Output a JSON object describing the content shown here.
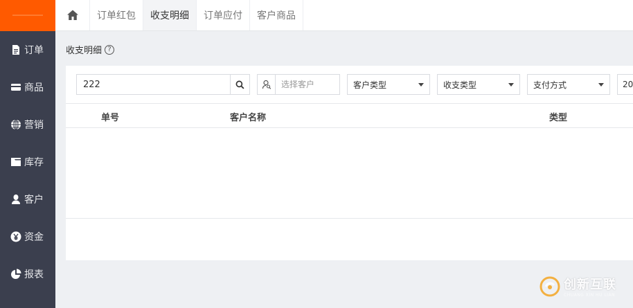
{
  "sidebar": {
    "items": [
      {
        "label": "订单",
        "icon": "document-icon"
      },
      {
        "label": "商品",
        "icon": "card-icon"
      },
      {
        "label": "营销",
        "icon": "globe-icon"
      },
      {
        "label": "库存",
        "icon": "box-icon"
      },
      {
        "label": "客户",
        "icon": "user-icon"
      },
      {
        "label": "资金",
        "icon": "yen-icon"
      },
      {
        "label": "报表",
        "icon": "pie-chart-icon"
      }
    ]
  },
  "tabs": [
    {
      "label": "订单红包",
      "active": false
    },
    {
      "label": "收支明细",
      "active": true
    },
    {
      "label": "订单应付",
      "active": false
    },
    {
      "label": "客户商品",
      "active": false
    }
  ],
  "page": {
    "title": "收支明细",
    "help_glyph": "?"
  },
  "filters": {
    "search_value": "222",
    "customer_placeholder": "选择客户",
    "customer_type": "客户类型",
    "income_type": "收支类型",
    "payment_method": "支付方式",
    "date_partial": "20"
  },
  "table": {
    "headers": [
      "单号",
      "客户名称",
      "类型"
    ]
  },
  "watermark": {
    "text": "创新互联",
    "sub": "CHUANG XIN HU LIAN"
  },
  "colors": {
    "brand_orange": "#ff5a00",
    "sidebar_bg": "#3b3f4e"
  }
}
